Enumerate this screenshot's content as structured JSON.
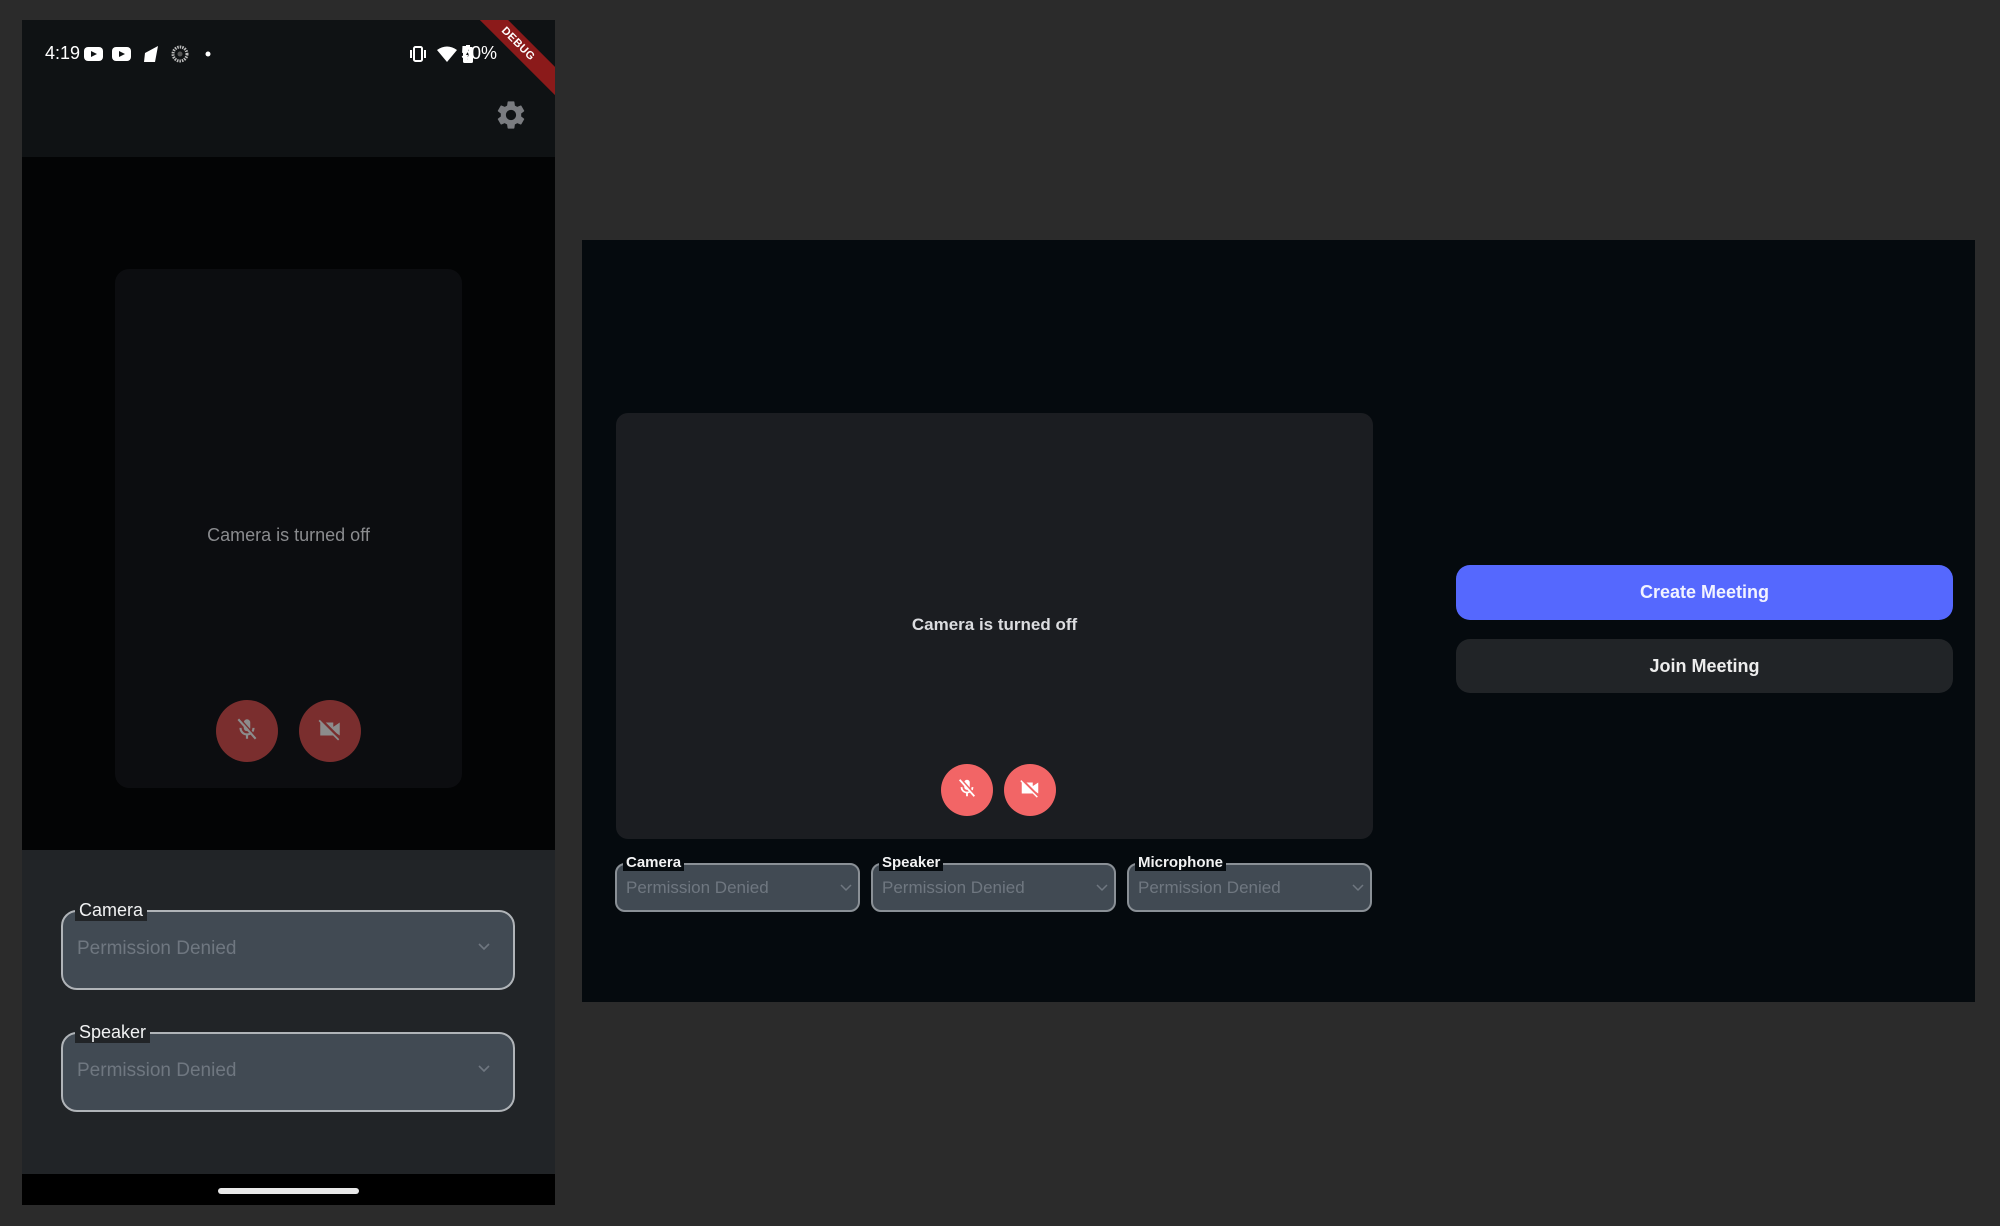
{
  "mobile": {
    "status_bar": {
      "time": "4:19",
      "left_icons": [
        "youtube-icon",
        "youtube-icon",
        "signal-icon",
        "spinner-icon",
        "dot-icon"
      ],
      "right_icons": [
        "vibrate-icon",
        "wifi-icon",
        "battery-charging-icon"
      ],
      "battery": "50%"
    },
    "debug_banner": "DEBUG",
    "app_bar": {
      "settings_icon": "gear-icon"
    },
    "preview": {
      "message": "Camera is turned off",
      "mic_state": "muted",
      "camera_state": "off"
    },
    "device_fields": [
      {
        "label": "Camera",
        "value": "Permission Denied"
      },
      {
        "label": "Speaker",
        "value": "Permission Denied"
      }
    ]
  },
  "desktop": {
    "preview": {
      "message": "Camera is turned off",
      "mic_state": "muted",
      "camera_state": "off"
    },
    "device_fields": [
      {
        "label": "Camera",
        "value": "Permission Denied"
      },
      {
        "label": "Speaker",
        "value": "Permission Denied"
      },
      {
        "label": "Microphone",
        "value": "Permission Denied"
      }
    ],
    "actions": {
      "create_label": "Create Meeting",
      "join_label": "Join Meeting"
    }
  },
  "colors": {
    "accent": "#5568fe",
    "danger_button": "#f26566",
    "danger_button_dimmed": "#7a2e2e",
    "debug_ribbon": "#8b1a1a"
  }
}
